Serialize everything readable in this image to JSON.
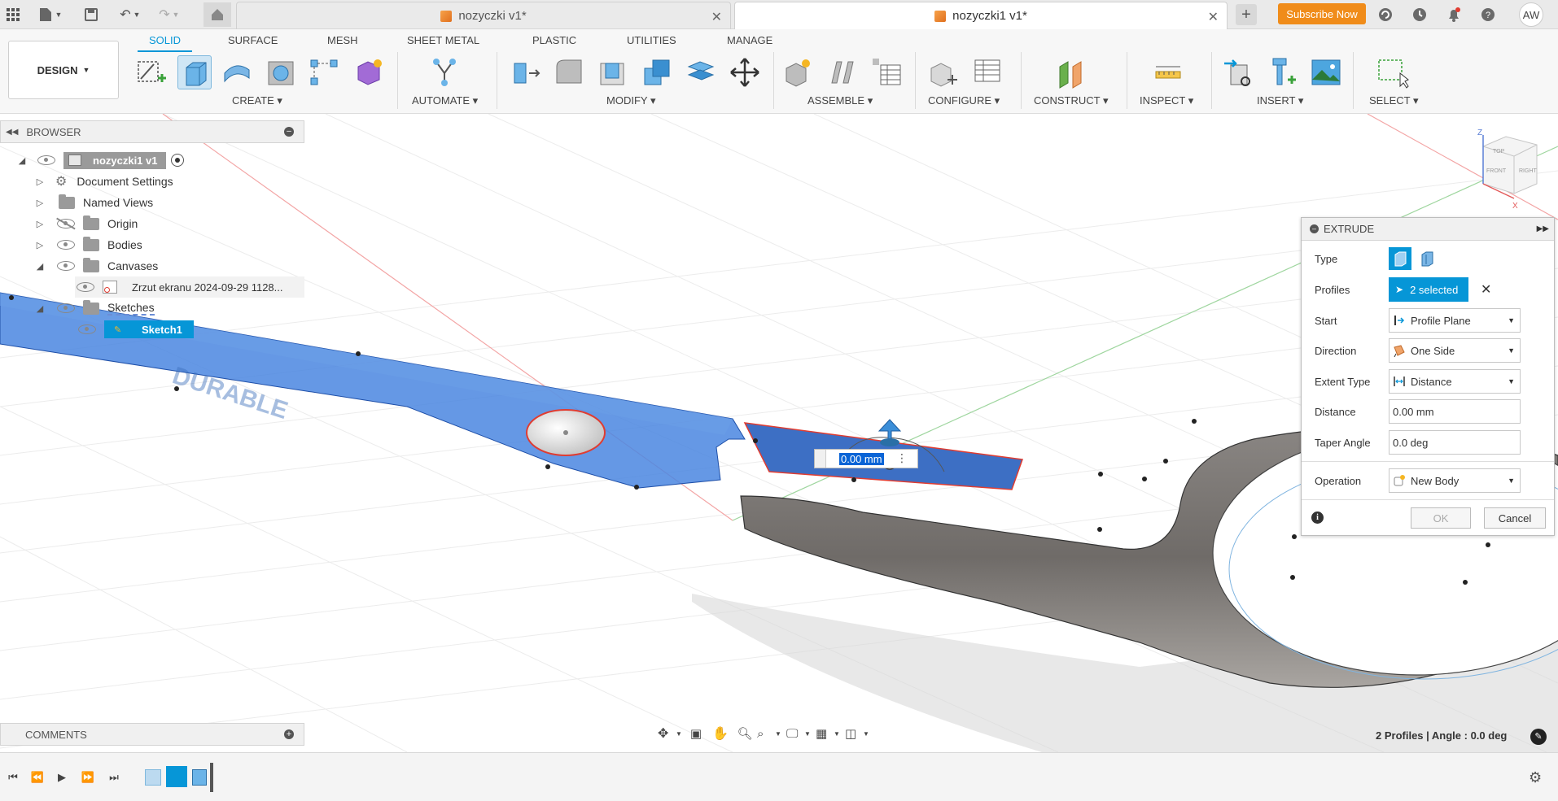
{
  "titlebar": {
    "tabs": [
      {
        "label": "nozyczki v1*",
        "active": false
      },
      {
        "label": "nozyczki1 v1*",
        "active": true
      }
    ],
    "subscribe_label": "Subscribe Now",
    "avatar_initials": "AW"
  },
  "toolbar": {
    "design_label": "DESIGN",
    "tabs": [
      "SOLID",
      "SURFACE",
      "MESH",
      "SHEET METAL",
      "PLASTIC",
      "UTILITIES",
      "MANAGE"
    ],
    "active_tab": "SOLID",
    "groups": [
      "CREATE",
      "AUTOMATE",
      "MODIFY",
      "ASSEMBLE",
      "CONFIGURE",
      "CONSTRUCT",
      "INSPECT",
      "INSERT",
      "SELECT"
    ]
  },
  "browser": {
    "header": "BROWSER",
    "items": [
      {
        "label": "nozyczki1 v1",
        "icon": "component-icon"
      },
      {
        "label": "Document Settings",
        "icon": "gear-icon"
      },
      {
        "label": "Named Views",
        "icon": "folder-icon"
      },
      {
        "label": "Origin",
        "icon": "folder-icon"
      },
      {
        "label": "Bodies",
        "icon": "folder-icon"
      },
      {
        "label": "Canvases",
        "icon": "folder-icon"
      },
      {
        "label": "Zrzut ekranu 2024-09-29 1128...",
        "icon": "canvas-image-icon"
      },
      {
        "label": "Sketches",
        "icon": "folder-icon"
      },
      {
        "label": "Sketch1",
        "icon": "sketch-icon"
      }
    ]
  },
  "viewport": {
    "dimension_input": "0.00 mm",
    "status": "2 Profiles | Angle : 0.0 deg",
    "watermark": "DURABLE"
  },
  "extrude": {
    "title": "EXTRUDE",
    "type_label": "Type",
    "profiles_label": "Profiles",
    "profiles_value": "2 selected",
    "start_label": "Start",
    "start_value": "Profile Plane",
    "direction_label": "Direction",
    "direction_value": "One Side",
    "extent_label": "Extent Type",
    "extent_value": "Distance",
    "distance_label": "Distance",
    "distance_value": "0.00 mm",
    "taper_label": "Taper Angle",
    "taper_value": "0.0 deg",
    "operation_label": "Operation",
    "operation_value": "New Body",
    "ok_label": "OK",
    "cancel_label": "Cancel"
  },
  "comments": {
    "label": "COMMENTS"
  },
  "viewcube": {
    "top": "TOP",
    "right": "RIGHT",
    "front": "FRONT",
    "axis_z": "Z",
    "axis_x": "X"
  }
}
